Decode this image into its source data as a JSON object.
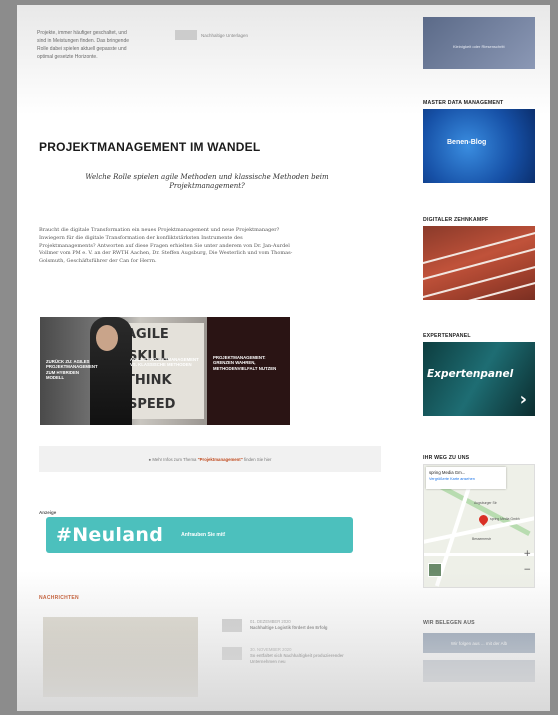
{
  "top_text": "Projekte, immer häufiger geschaltet, und sind in Meistungen finden. Das bringende Rolle dabei spielen aktuell gepasste und optimal gesetzte Horizonte.",
  "top_mini": "Nachhaltige Unterlagen",
  "article": {
    "title": "PROJEKTMANAGEMENT IM WANDEL",
    "lead": "Welche Rolle spielen agile Methoden und klassische Methoden beim Projektmanagement?",
    "body": "Braucht die digitale Transformation ein neues Projektmanagement und neue Projektmanager? Inwiegern für die digitale Transformation der konfliktstärksten Instrumente des Projektmanagements? Antworten auf diese Fragen erhielten Sie unter anderem von Dr. Jan-Aurdel Vollmer vom PM e. V. an der RWTH Aachen, Dr. Steffen Augsburg, Die Westerlich und vom Thomas-Golsmuth, Geschäftsführer der Can for Herrn."
  },
  "hero": {
    "board_text": [
      "AGILE",
      "SKILL",
      "THINK",
      "SPEED"
    ],
    "cap1": "Zurück zu: agiles Projektmanagement zum hybriden Modell",
    "cap2": "Agiles Projektmanagement vs. klassische Methoden",
    "cap3": "Projektmanagement: Grenzen wahren, Methodenvielfalt nutzen"
  },
  "notice": {
    "prefix": "Mehr Infos zum Thema",
    "topic": "\"Projektmanagement\"",
    "suffix": "finden Sie hier"
  },
  "ad": {
    "label": "Anzeige",
    "title": "#Neuland",
    "cta": "Anfrauben Sie mit!"
  },
  "news": {
    "heading": "NACHRICHTEN",
    "items": [
      {
        "date": "01. DEZEMBER 2020",
        "title": "Nachhaltige Logistik fördert den Erfolg"
      },
      {
        "date": "30. NOVEMBER 2020",
        "title": "So entfaltet sich Nachhaltigkeit produzierender Unternehmen neu"
      }
    ]
  },
  "sidebar": {
    "top_caption": "Kleinigkeit oder Riesenschritt",
    "mdm": {
      "heading": "MASTER DATA MANAGEMENT",
      "image_text": "Benen-Blog"
    },
    "zeh": {
      "heading": "DIGITALER ZEHNKAMPF"
    },
    "exp": {
      "heading": "EXPERTENPANEL",
      "image_text": "Expertenpanel",
      "arrow": "›"
    },
    "map": {
      "heading": "IHR WEG ZU UNS",
      "place": "spring Media Gm...",
      "link": "Vergrößerte Karte ansehen",
      "label1": "spring Media Gmbh",
      "label2": "Augsburger Str",
      "label3": "Bessemerstr",
      "zoom_in": "+",
      "zoom_out": "−"
    },
    "follow": {
      "heading": "WIR BELEGEN AUS",
      "button": "Wir folgen aus ... mit der Alb"
    }
  }
}
